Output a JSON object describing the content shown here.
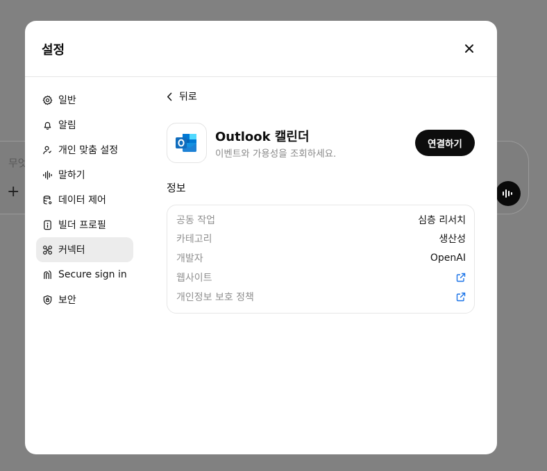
{
  "background": {
    "composer_placeholder": "무엇",
    "plus": "+"
  },
  "modal": {
    "title": "설정"
  },
  "sidebar": {
    "items": [
      {
        "label": "일반",
        "icon": "gear-icon"
      },
      {
        "label": "알림",
        "icon": "bell-icon"
      },
      {
        "label": "개인 맞춤 설정",
        "icon": "personalization-icon"
      },
      {
        "label": "말하기",
        "icon": "voice-wave-icon"
      },
      {
        "label": "데이터 제어",
        "icon": "database-icon"
      },
      {
        "label": "빌더 프로필",
        "icon": "id-card-icon"
      },
      {
        "label": "커넥터",
        "icon": "connectors-icon",
        "active": true
      },
      {
        "label": "Secure sign in",
        "icon": "secure-sign-in-icon"
      },
      {
        "label": "보안",
        "icon": "shield-lock-icon"
      }
    ]
  },
  "content": {
    "back_label": "뒤로",
    "app_name": "Outlook 캘린더",
    "app_description": "이벤트와 가용성을 조회하세요.",
    "connect_label": "연결하기",
    "info_title": "정보",
    "info_rows": [
      {
        "label": "공동 작업",
        "value": "심층 리서치"
      },
      {
        "label": "카테고리",
        "value": "생산성"
      },
      {
        "label": "개발자",
        "value": "OpenAI"
      },
      {
        "label": "웹사이트",
        "value": "",
        "icon": "external-link-icon"
      },
      {
        "label": "개인정보 보호 정책",
        "value": "",
        "icon": "external-link-icon"
      }
    ]
  },
  "colors": {
    "overlay": "#818181",
    "accent_button": "#0d0d0d",
    "active_nav": "#ececec",
    "outlook_blue": "#0f6cbd"
  }
}
